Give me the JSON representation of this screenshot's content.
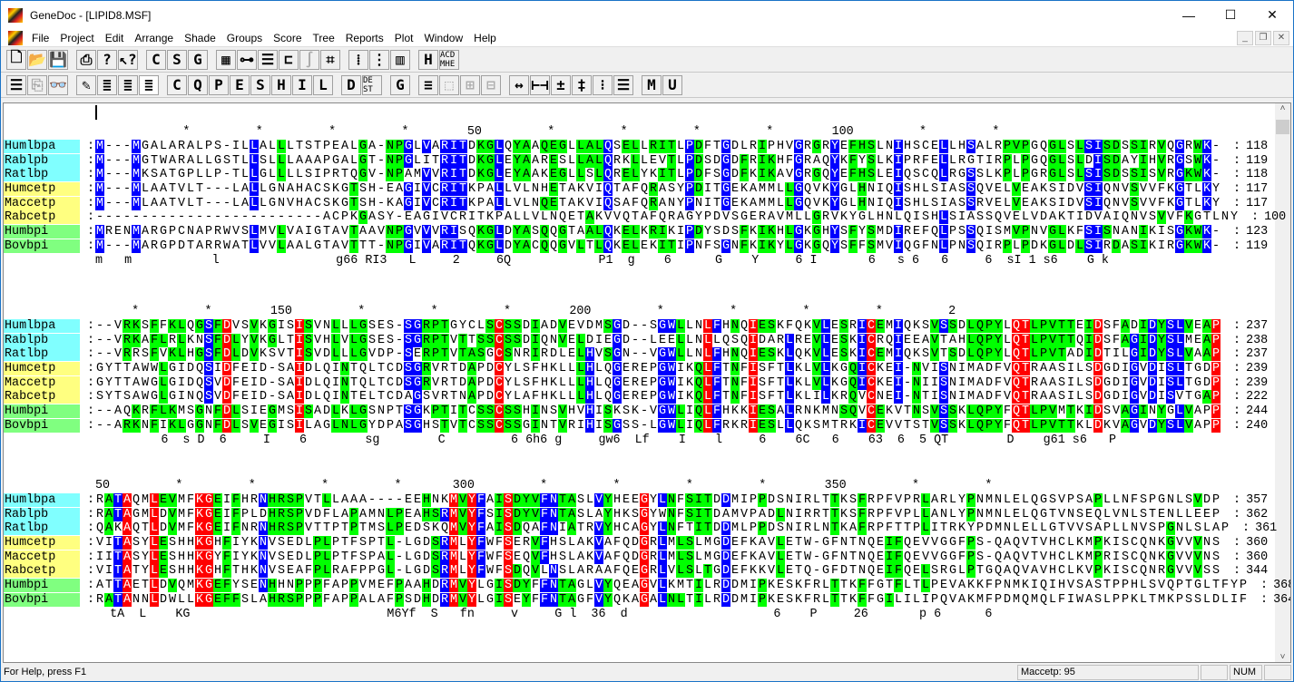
{
  "window": {
    "title": "GeneDoc - [LIPID8.MSF]",
    "minimize": "—",
    "maximize": "☐",
    "close": "✕"
  },
  "menu": [
    "File",
    "Project",
    "Edit",
    "Arrange",
    "Shade",
    "Groups",
    "Score",
    "Tree",
    "Reports",
    "Plot",
    "Window",
    "Help"
  ],
  "mdi": {
    "minimize": "_",
    "restore": "❐",
    "close": "✕"
  },
  "toolbar1": [
    {
      "name": "new-icon",
      "glyph": "🗋"
    },
    {
      "name": "open-icon",
      "glyph": "📂"
    },
    {
      "name": "save-icon",
      "glyph": "💾"
    },
    {
      "sep": true
    },
    {
      "name": "print-icon",
      "glyph": "⎙"
    },
    {
      "name": "help-icon",
      "glyph": "?"
    },
    {
      "name": "context-help-icon",
      "glyph": "↖?"
    },
    {
      "sep": true
    },
    {
      "name": "conserved-mode-button",
      "glyph": "C"
    },
    {
      "name": "similarity-mode-button",
      "glyph": "S"
    },
    {
      "name": "group-mode-button",
      "glyph": "G"
    },
    {
      "sep": true
    },
    {
      "name": "grid-icon",
      "glyph": "▦"
    },
    {
      "name": "link-icon",
      "glyph": "⊶"
    },
    {
      "name": "list-icon",
      "glyph": "☰"
    },
    {
      "name": "tree-icon",
      "glyph": "⊏"
    },
    {
      "name": "curve-icon",
      "glyph": "∫",
      "dim": true
    },
    {
      "name": "matrix-icon",
      "glyph": "⌗"
    },
    {
      "sep": true
    },
    {
      "name": "dots-grid-icon",
      "glyph": "⁞"
    },
    {
      "name": "dots-bar-icon",
      "glyph": "⋮"
    },
    {
      "name": "dots-full-icon",
      "glyph": "▥"
    },
    {
      "sep": true
    },
    {
      "name": "hi-icon",
      "glyph": "H"
    },
    {
      "name": "acd-mhe-icon",
      "glyph": "ACD MHE",
      "small": true
    }
  ],
  "toolbar2": [
    {
      "name": "lines-icon",
      "glyph": "☰"
    },
    {
      "name": "copy-icon",
      "glyph": "⎘",
      "dim": true
    },
    {
      "name": "find-icon",
      "glyph": "👓"
    },
    {
      "sep": true
    },
    {
      "name": "edit-icon",
      "glyph": "✎"
    },
    {
      "name": "shade-left-icon",
      "glyph": "≣"
    },
    {
      "name": "shade-mid-icon",
      "glyph": "≣"
    },
    {
      "name": "shade-right-icon",
      "glyph": "≣",
      "pressed": true
    },
    {
      "sep": true
    },
    {
      "name": "property-c-button",
      "glyph": "C"
    },
    {
      "name": "property-q-button",
      "glyph": "Q"
    },
    {
      "name": "property-p-button",
      "glyph": "P"
    },
    {
      "name": "property-e-button",
      "glyph": "E"
    },
    {
      "name": "property-s-button",
      "glyph": "S"
    },
    {
      "name": "property-h-button",
      "glyph": "H"
    },
    {
      "name": "property-i-button",
      "glyph": "I"
    },
    {
      "name": "property-l-button",
      "glyph": "L"
    },
    {
      "sep": true
    },
    {
      "name": "d-button",
      "glyph": "D"
    },
    {
      "name": "dest-button",
      "glyph": "DE ST",
      "small": true
    },
    {
      "sep": true
    },
    {
      "name": "g-button",
      "glyph": "G"
    },
    {
      "sep": true
    },
    {
      "name": "stack-icon",
      "glyph": "≡"
    },
    {
      "name": "box-icon",
      "glyph": "⬚",
      "dim": true
    },
    {
      "name": "grid-box-icon",
      "glyph": "⊞",
      "dim": true
    },
    {
      "name": "dash-box-icon",
      "glyph": "⊟",
      "dim": true
    },
    {
      "sep": true
    },
    {
      "name": "expand-icon",
      "glyph": "↔"
    },
    {
      "name": "bracket-icon",
      "glyph": "⊢⊣"
    },
    {
      "name": "plusminus-icon",
      "glyph": "±"
    },
    {
      "name": "split-icon",
      "glyph": "‡"
    },
    {
      "name": "vsplit-icon",
      "glyph": "⁝"
    },
    {
      "name": "list-lines-icon",
      "glyph": "☰"
    },
    {
      "sep": true
    },
    {
      "name": "m-button",
      "glyph": "M"
    },
    {
      "name": "u-button",
      "glyph": "U"
    }
  ],
  "names": [
    "Humlbpa",
    "Rablpb",
    "Ratlbp",
    "Humcetp",
    "Maccetp",
    "Rabcetp",
    "Humbpi",
    "Bovbpi"
  ],
  "name_colors": [
    "#80ffff",
    "#80ffff",
    "#80ffff",
    "#ffff80",
    "#ffff80",
    "#ffff80",
    "#80ff80",
    "#80ff80"
  ],
  "blocks": [
    {
      "ruler": "            *         *         *         *        50         *         *         *         *        100         *         *   ",
      "seqs": [
        "M---MGALARALPS-ILLALLLTSTPEALGA-NPGLVARITDKGLQYAAQEGLLALQSELLRITLPDFTGDLRIPHVGRGRYEFHSLNIHSCELLHSALRPVPGQGLSLSISDSSIRVQGRWK-",
        "M---MGTWARALLGSTLLSLLLAAAPGALGT-NPGLITRITDKGLEYAARESLLALQRKLLEVTLPDSDGDFRIKHFGRAQYKFYSLKIPRFELLRGTIRPLPGQGLSLDISDAYIHVRGSWK-",
        "M---MKSATGPLLP-TLLGLLLLSIPRTQGV-NPAMVVRITDKGLEYAAKEGLLSLQRELYKITLPDFSGDFKIKAVGRGQYEFHSLEIQSCQLRGSSLKPLPGRGLSLSISDSSISVRGKWK-",
        "M---MLAATVLT---LALLGNAHACSKGTSH-EAGIVCRITKPALLVLNHETAKVIQTAFQRASYPDITGEKAMMLLGQVKYGLHNIQISHLSIASSQVELVEAKSIDVSIQNVSVVFKGTLKY",
        "M---MLAATVLT---LALLGNVHACSKGTSH-KAGIVCRITKPALLVLNQETAKVIQSAFQRANYPNITGEKAMMLLGQVKYGLHNIQISHLSIASSRVELVEAKSIDVSIQNVSVVFKGTLKY",
        "-------------------------ACPKGASY-EAGIVCRITKPALLVLNQETAKVVQTAFQRAGYPDVSGERAVMLLGRVKYGLHNLQISHLSIASSQVELVDAKTIDVAIQNVSVVFKGTLNY",
        "MRENMARGPCNAPRWVSLMVLVAIGTAVTAAVNPGVVVRISQKGLDYASQQGTAALQKELKRIKIPDYSDSFKIKHLGKGHYSFYSMDIREFQLPSSQISMVPNVGLKFSISNANIKISGKWK-",
        "M---MARGPDTARRWATLVVLAALGTAVTTT-NPGIVARITQKGLDYACQQGVLTLQKELEKITIPNFSGNFKIKYLGKGQYSFFSMVIQGFNLPNSQIRPLPDKGLDLSIRDASIKIRGKWK-"
      ],
      "counts": [
        "118",
        "119",
        "118",
        "117",
        "117",
        "100",
        "123",
        "119"
      ],
      "consensus": "m   m           l                g66 RI3   L     2     6Q            P1  g    6      G    Y     6 I       6   s 6   6     6  sI 1 s6    G k"
    },
    {
      "ruler": "     *         *        150         *         *         *        200         *         *         *         *         2",
      "seqs": [
        "--VRKSFFKLQGSFDVSVKGISISVNLLLGSES-SGRPTGYCLSCSSDIADVEVDMSGD--SGWLLNLFHNQIESKFQKVLESRICEMIQKSVSSDLQPYLQTLPVTTEIDSFADIDYSLVEAP",
        "--VRKAFLRLKNSFDLYVKGLTISVHLVLGSES-SGRPTVTTSSCSSDIQNVELDIEGD--LEELLNLLQSQIDARLREVLESKICRQIEEAVTAHLQPYLQTLPVTTQIDSFAGIDYSLMEAP",
        "--VRRSFVKLHGSFDLDVKSVTISVDLLLGVDP-SERPTVTASGCSNRIRDLELHVSGN--VGWLLNLFHNQIESKLQKVLESKICEMIQKSVTSDLQPYLQTLPVTADIDTILGIDYSLVAAP",
        "GYTTAWWLGIDQSIDFEID-SAIDLQINTQLTCDSGRVRTDAPDCYLSFHKLLLHLQGEREPGWIKQLFTNFISFTLKLVLKGQICKEI-NVISNIMADFVQTRAASILSDGDIGVDISLTGDP",
        "GYTTAWGLGIDQSVDFEID-SAIDLQINTQLTCDSGRVRTDAPDCYLSFHKLLLHLQGEREPGWIKQLFTNFISFTLKLVLKGQICKEI-NIISNIMADFVQTRAASILSDGDIGVDISLTGDP",
        "SYTSAWGLGINQSVDFEID-SAIDLQINTELTCDAGSVRTNAPDCYLAFHKLLLHLQGEREPGWIKQLFTNFISFTLKLILKRQVCNEI-NTISNIMADFVQTRAASILSDGDIGVDISVTGAP",
        "--AQKRFLKMSGNFDLSIEGMSISADLKLGSNPTSGKPTITCSSCSSHINSVHVHISKSK-VGWLIQLFHKKIESALRNKMNSQVCEKVTNSVSSKLQPYFQTLPVMTKIDSVAGINYGLVAPP",
        "--ARKNFIKLGGNFDLSVEGISILAGLNLGYDPASGHSTVTCSSCSSGINTVRIHISGSS-LGWLIQLFRKRIESLLQKSMTRKICEVVTSTVSSKLQPYFQTLPVTTKLDKVAGVDYSLVAPP"
      ],
      "counts": [
        "237",
        "238",
        "237",
        "239",
        "239",
        "222",
        "244",
        "240"
      ],
      "consensus": "         6  s D  6     I    6        sg        C         6 6h6 g     gw6  Lf    I    l     6    6C   6    63  6  5 QT        D    g61 s6   P"
    },
    {
      "ruler": "50         *         *         *         *       300         *         *         *         *        350         *         *   ",
      "seqs": [
        "RATAQMLEVMFKGEIFHRNHRSPVTLLAAA----EEHNKMVYFAISDYVFNTASLVYHEEGYLNFSITDDMIPPDSNIRLTTKSFRPFVPRLARLYPNMNLELQGSVPSAPLLNFSPGNLSVDP",
        "RATAGMLDVMFKGEIFPLDHRSPVDFLAPAMNLPEAHSRMVYFSISDYVFNTASLAYHKSGYWNFSITDAMVPADLNIRRTTKSFRPFVPLLANLYPNMNLELQGTVNSEQLVNLSTENLLEEP",
        "QAKAQTLDVMFKGEIFNRNHRSPVTTPTPTMSLPEDSKQMVYFAISDQAFNIATRVYHCAGYLNFTITDDMLPPDSNIRLNTKAFRPFTTPLITRKYPDMNLELLGTVVSAPLLNVSPGNLSLAP",
        "VITASYLESHHKGHFIYKNVSEDLPLPTFSPTL-LGDSRMLYFWFSERVFHSLAKVAFQDGRLMLSLMGDEFKAVLETW-GFNTNQEIFQEVVGGFPS-QAQVTVHCLKMPKISCQNKGVVVNS",
        "IITASYLESHHKGYFIYKNVSEDLPLPTFSPAL-LGDSRMLYFWFSEQVFHSLAKVAFQDGRLMLSLMGDEFKAVLETW-GFNTNQEIFQEVVGGFPS-QAQVTVHCLKMPRISCQNKGVVVNS",
        "VITATYLESHHKGHFTHKNVSEAFPLRAFPPGL-LGDSRMLYFWFSDQVLNSLARAAFQEGRLVLSLTGDEFKKVLETQ-GFDTNQEIFQELSRGLPTGQAQVAVHCLKVPKISCQNRGVVVSS",
        "ATTAETLDVQMKGEFYSENHHNPPPFAPPVMEFPAAHDRMVYLGISDYFFNTAGLVYQEAGVLKMTILRDDMIPKESKFRLTTKFFGTFLTLPEVAKKFPNMKIQIHVSASTPPHLSVQPTGLTFYP",
        "RATANNLDWLLKGEFFSLAHRSPPPFAPPALAFPSDHDRMVYLGISEYFFNTAGFVYQKAGALNLTILRDDMIPKESKFRLTTKFFGILILIPQVAKMFPDMQMQLFIWASLPPKLTMKPSSLDLIF"
      ],
      "counts": [
        "357",
        "362",
        "361",
        "360",
        "360",
        "344",
        "368",
        "364"
      ],
      "consensus": "  tA  L    KG                           M6Yf  S   fn     v     G l  36  d                    6    P     26       p 6      6"
    }
  ],
  "status": {
    "help": "For Help, press F1",
    "selection": "Maccetp: 95",
    "num": "NUM"
  }
}
